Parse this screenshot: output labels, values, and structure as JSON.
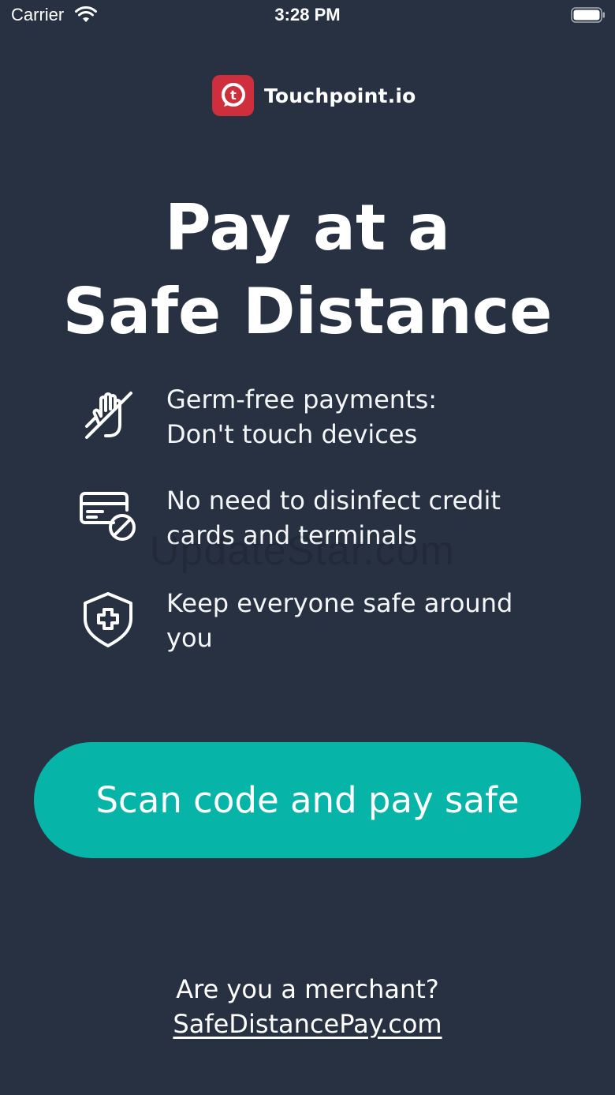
{
  "status_bar": {
    "carrier": "Carrier",
    "time": "3:28 PM"
  },
  "logo": {
    "brand": "Touchpoint.io",
    "mark_letter": "t",
    "color": "#cf2e3c"
  },
  "headline": {
    "line1": "Pay at a",
    "line2": "Safe Distance"
  },
  "features": [
    {
      "icon": "no-touch-hand-icon",
      "text": "Germ-free payments:\nDon't touch devices"
    },
    {
      "icon": "card-blocked-icon",
      "text": "No need to disinfect credit\ncards and terminals"
    },
    {
      "icon": "shield-plus-icon",
      "text": "Keep everyone safe around\nyou"
    }
  ],
  "cta": {
    "label": "Scan code and pay safe",
    "color": "#06b4a8"
  },
  "merchant": {
    "question": "Are you a merchant?",
    "link": "SafeDistancePay.com"
  },
  "watermark": "UpdateStar.com",
  "colors": {
    "background": "#283142"
  }
}
